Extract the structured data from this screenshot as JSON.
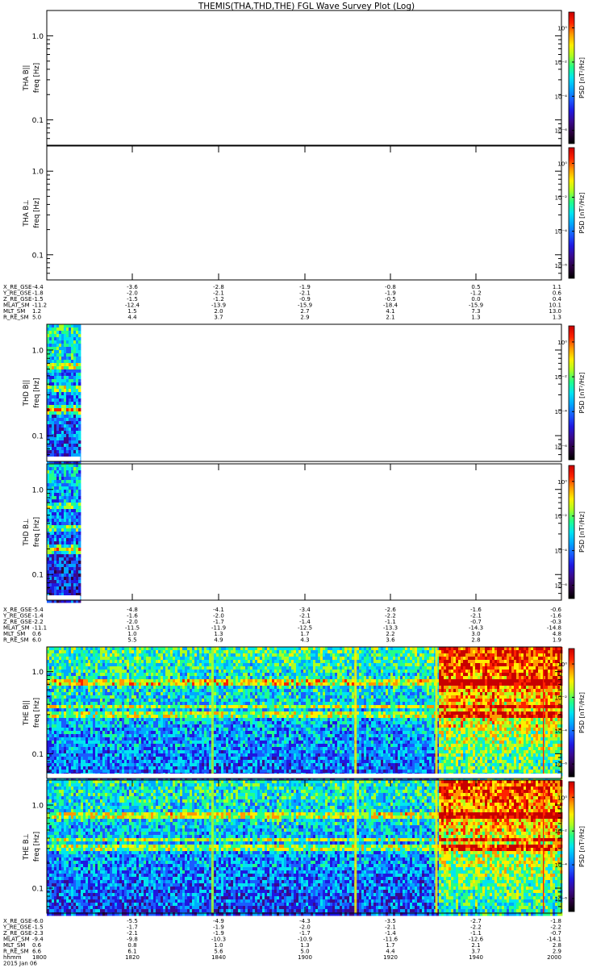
{
  "title": "THEMIS(THA,THD,THE) FGL Wave Survey Plot (Log)",
  "colors": {
    "colormap": [
      "#000000",
      "#2a003f",
      "#3a0a8c",
      "#1f18e0",
      "#1a5cff",
      "#00a8ff",
      "#00e5f0",
      "#22ff88",
      "#aaff22",
      "#ffee00",
      "#ff9900",
      "#ff2200",
      "#c80000"
    ]
  },
  "chart_data": {
    "type": "heatmap",
    "x": {
      "range": [
        "1800",
        "2000"
      ],
      "tick_labels": [
        "1800",
        "1820",
        "1840",
        "1900",
        "1920",
        "1940",
        "2000"
      ],
      "label": "hhmm",
      "date": "2015 Jan 06"
    },
    "panels": [
      {
        "probe": "THA",
        "component": "B||",
        "ylabel_line1": "THA B||",
        "ylabel_line2": "freq [Hz]",
        "zlabel": "PSD [nT²/Hz]",
        "ylim": [
          0.05,
          2.0
        ],
        "y_scale": "log",
        "y_ticks": [
          "1.0",
          "0.1"
        ],
        "z_ticks": [
          "10⁰",
          "10⁻²",
          "10⁻⁴",
          "10⁻⁶"
        ],
        "data_coverage": [
          0,
          0
        ],
        "mean_level": 0
      },
      {
        "probe": "THA",
        "component": "B⊥",
        "ylabel_line1": "THA B⊥",
        "ylabel_line2": "freq [Hz]",
        "zlabel": "PSD [nT²/Hz]",
        "ylim": [
          0.05,
          2.0
        ],
        "y_scale": "log",
        "y_ticks": [
          "1.0",
          "0.1"
        ],
        "z_ticks": [
          "10⁰",
          "10⁻²",
          "10⁻⁴",
          "10⁻⁶"
        ],
        "data_coverage": [
          0,
          0
        ],
        "mean_level": 0
      },
      {
        "probe": "THD",
        "component": "B||",
        "ylabel_line1": "THD B||",
        "ylabel_line2": "freq [Hz]",
        "zlabel": "PSD [nT²/Hz]",
        "ylim": [
          0.05,
          2.0
        ],
        "y_scale": "log",
        "y_ticks": [
          "1.0",
          "0.1"
        ],
        "z_ticks": [
          "10⁰",
          "10⁻²",
          "10⁻⁴",
          "10⁻⁶"
        ],
        "data_coverage": [
          0,
          0.065
        ],
        "mean_level": 0.4
      },
      {
        "probe": "THD",
        "component": "B⊥",
        "ylabel_line1": "THD B⊥",
        "ylabel_line2": "freq [Hz]",
        "zlabel": "PSD [nT²/Hz]",
        "ylim": [
          0.05,
          2.0
        ],
        "y_scale": "log",
        "y_ticks": [
          "1.0",
          "0.1"
        ],
        "z_ticks": [
          "10⁰",
          "10⁻²",
          "10⁻⁴",
          "10⁻⁶"
        ],
        "data_coverage": [
          0,
          0.065
        ],
        "mean_level": 0.35
      },
      {
        "probe": "THE",
        "component": "B||",
        "ylabel_line1": "THE B||",
        "ylabel_line2": "freq [Hz]",
        "zlabel": "PSD [nT²/Hz]",
        "ylim": [
          0.05,
          2.0
        ],
        "y_scale": "log",
        "y_ticks": [
          "1.0",
          "0.1"
        ],
        "z_ticks": [
          "10⁰",
          "10⁻²",
          "10⁻⁴",
          "10⁻⁶"
        ],
        "data_coverage": [
          0,
          1
        ],
        "mean_level": 0.45
      },
      {
        "probe": "THE",
        "component": "B⊥",
        "ylabel_line1": "THE B⊥",
        "ylabel_line2": "freq [Hz]",
        "zlabel": "PSD [nT²/Hz]",
        "ylim": [
          0.05,
          2.0
        ],
        "y_scale": "log",
        "y_ticks": [
          "1.0",
          "0.1"
        ],
        "z_ticks": [
          "10⁰",
          "10⁻²",
          "10⁻⁴",
          "10⁻⁶"
        ],
        "data_coverage": [
          0,
          1
        ],
        "mean_level": 0.42
      }
    ],
    "ephemeris": [
      {
        "probe": "THA",
        "rows": [
          {
            "label": "X_RE_GSE",
            "values": [
              "-4.4",
              "-3.6",
              "-2.8",
              "-1.9",
              "-0.8",
              "0.5",
              "1.1"
            ]
          },
          {
            "label": "Y_RE_GSE",
            "values": [
              "-1.8",
              "-2.0",
              "-2.1",
              "-2.1",
              "-1.9",
              "-1.2",
              "0.6"
            ]
          },
          {
            "label": "Z_RE_GSE",
            "values": [
              "-1.5",
              "-1.5",
              "-1.2",
              "-0.9",
              "-0.5",
              "0.0",
              "0.4"
            ]
          },
          {
            "label": "MLAT_SM",
            "values": [
              "-11.2",
              "-12.4",
              "-13.9",
              "-15.9",
              "-18.4",
              "-15.9",
              "10.1"
            ]
          },
          {
            "label": "MLT_SM",
            "values": [
              "1.2",
              "1.5",
              "2.0",
              "2.7",
              "4.1",
              "7.3",
              "13.0"
            ]
          },
          {
            "label": "R_RE_SM",
            "values": [
              "5.0",
              "4.4",
              "3.7",
              "2.9",
              "2.1",
              "1.3",
              "1.3"
            ]
          }
        ]
      },
      {
        "probe": "THD",
        "rows": [
          {
            "label": "X_RE_GSE",
            "values": [
              "-5.4",
              "-4.8",
              "-4.1",
              "-3.4",
              "-2.6",
              "-1.6",
              "-0.6"
            ]
          },
          {
            "label": "Y_RE_GSE",
            "values": [
              "-1.4",
              "-1.6",
              "-2.0",
              "-2.1",
              "-2.2",
              "-2.1",
              "-1.6"
            ]
          },
          {
            "label": "Z_RE_GSE",
            "values": [
              "-2.2",
              "-2.0",
              "-1.7",
              "-1.4",
              "-1.1",
              "-0.7",
              "-0.3"
            ]
          },
          {
            "label": "MLAT_SM",
            "values": [
              "-11.1",
              "-11.5",
              "-11.9",
              "-12.5",
              "-13.3",
              "-14.3",
              "-14.8"
            ]
          },
          {
            "label": "MLT_SM",
            "values": [
              "0.6",
              "1.0",
              "1.3",
              "1.7",
              "2.2",
              "3.0",
              "4.8"
            ]
          },
          {
            "label": "R_RE_SM",
            "values": [
              "6.0",
              "5.5",
              "4.9",
              "4.3",
              "3.6",
              "2.8",
              "1.9"
            ]
          }
        ]
      },
      {
        "probe": "THE",
        "rows": [
          {
            "label": "X_RE_GSE",
            "values": [
              "-6.0",
              "-5.5",
              "-4.9",
              "-4.3",
              "-3.5",
              "-2.7",
              "-1.8"
            ]
          },
          {
            "label": "Y_RE_GSE",
            "values": [
              "-1.5",
              "-1.7",
              "-1.9",
              "-2.0",
              "-2.1",
              "-2.2",
              "-2.2"
            ]
          },
          {
            "label": "Z_RE_GSE",
            "values": [
              "-2.3",
              "-2.1",
              "-1.9",
              "-1.7",
              "-1.4",
              "-1.1",
              "-0.7"
            ]
          },
          {
            "label": "MLAT_SM",
            "values": [
              "-9.4",
              "-9.8",
              "-10.3",
              "-10.9",
              "-11.6",
              "-12.6",
              "-14.1"
            ]
          },
          {
            "label": "MLT_SM",
            "values": [
              "0.6",
              "0.8",
              "1.0",
              "1.3",
              "1.7",
              "2.1",
              "2.8"
            ]
          },
          {
            "label": "R_RE_SM",
            "values": [
              "6.6",
              "6.1",
              "5.6",
              "5.0",
              "4.4",
              "3.7",
              "2.9"
            ]
          }
        ]
      }
    ]
  }
}
